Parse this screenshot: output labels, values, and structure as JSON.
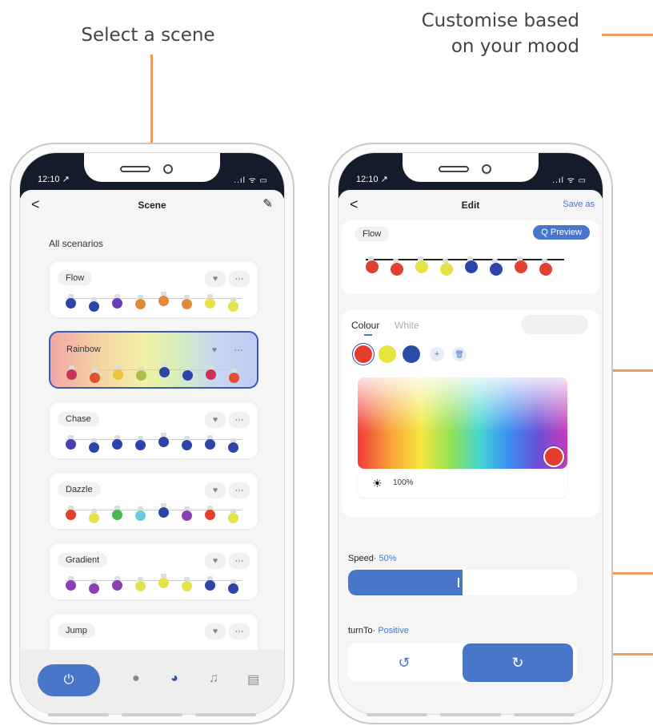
{
  "callouts": {
    "select_scene": "Select a scene",
    "customise": "Customise based on your mood"
  },
  "left_phone": {
    "status_time": "12:10 ↗",
    "status_icons": "..ıl ᯤ ▭",
    "header": {
      "back": "<",
      "title": "Scene",
      "edit": "✎"
    },
    "section_title": "All scenarios",
    "scenes": [
      {
        "name": "Flow",
        "bulbs": [
          "#2b46a8",
          "#2b46a8",
          "#6a3fb3",
          "#e08a3a",
          "#e08a3a",
          "#e08a3a",
          "#e6e34a",
          "#e6e34a"
        ]
      },
      {
        "name": "Rainbow",
        "selected": true,
        "bulbs": [
          "#c8335a",
          "#e0522e",
          "#efc23a",
          "#a8c04a",
          "#2b46a8",
          "#2b46a8",
          "#c8335a",
          "#e0522e"
        ]
      },
      {
        "name": "Chase",
        "bulbs": [
          "#4a3fb3",
          "#2b46a8",
          "#2b46a8",
          "#2b46a8",
          "#2b46a8",
          "#2b46a8",
          "#2b46a8",
          "#2b46a8"
        ]
      },
      {
        "name": "Dazzle",
        "bulbs": [
          "#e04030",
          "#e6e34a",
          "#4ab84a",
          "#6ac8e0",
          "#2b46a8",
          "#8a3fb3",
          "#e04030",
          "#e6e34a"
        ]
      },
      {
        "name": "Gradient",
        "bulbs": [
          "#8a3fb3",
          "#8a3fb3",
          "#8a3fb3",
          "#e6e34a",
          "#e6e34a",
          "#e6e34a",
          "#2b46a8",
          "#2b46a8"
        ]
      },
      {
        "name": "Jump",
        "bulbs": []
      }
    ],
    "card_heart": "♥",
    "card_more": "···",
    "bottom_nav": {
      "power": "⏻",
      "bulb": "●",
      "palette": "◕",
      "music": "♫",
      "schedule": "▤"
    }
  },
  "right_phone": {
    "status_time": "12:10 ↗",
    "status_icons": "..ıl ᯤ ▭",
    "header": {
      "back": "<",
      "title": "Edit",
      "save": "Save as"
    },
    "scene_name": "Flow",
    "preview_label": "Q Preview",
    "preview_bulbs": [
      "#e04030",
      "#e04030",
      "#e6e34a",
      "#e6e34a",
      "#2b46a8",
      "#2b46a8",
      "#e04030",
      "#e04030"
    ],
    "tabs": {
      "colour": "Colour",
      "white": "White"
    },
    "swatches": [
      "#e43b2e",
      "#e8e440",
      "#2b4da8"
    ],
    "add_icon": "+",
    "delete_icon": "🗑",
    "brightness": "100%",
    "speed_label": "Speed·",
    "speed_value": "50%",
    "speed_fraction": 0.5,
    "turn_label": "turnTo·",
    "turn_value": "Positive",
    "ccw_icon": "↺",
    "cw_icon": "↻",
    "accent": "#4877c9"
  }
}
